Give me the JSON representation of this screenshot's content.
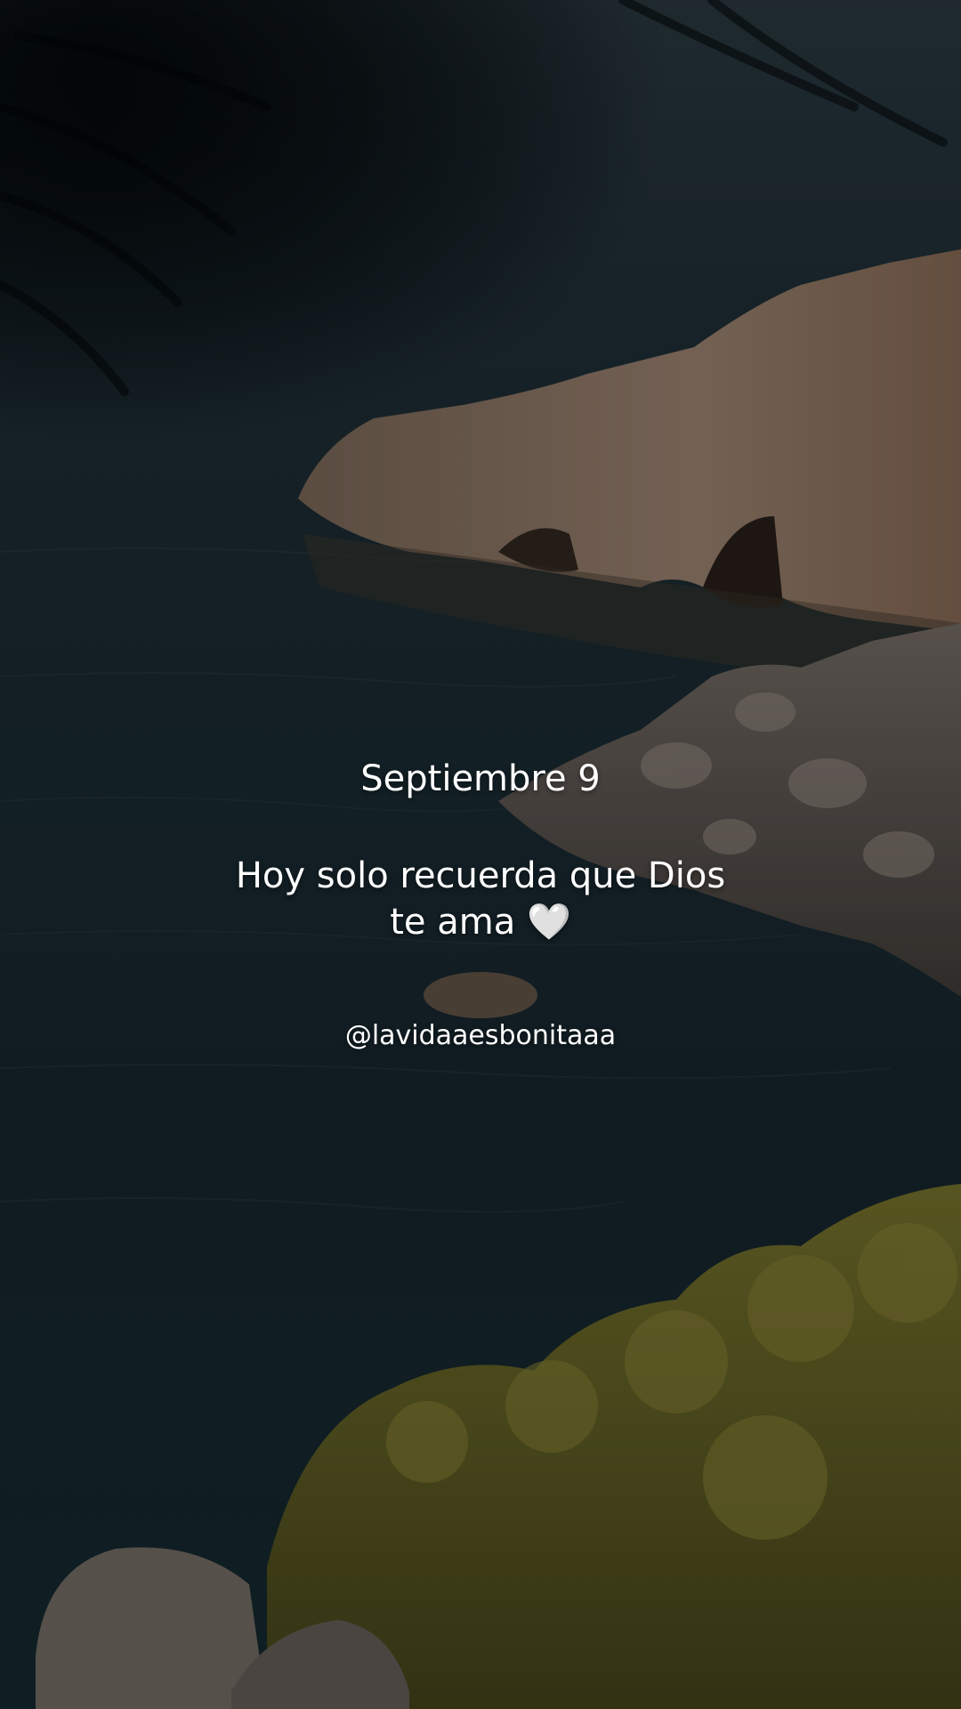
{
  "post": {
    "date": "Septiembre 9",
    "message_line1": "Hoy solo recuerda que Dios",
    "message_line2": "te ama 🤍",
    "handle": "@lavidaaesbonitaaa"
  },
  "scene": {
    "description_icon": "coastal-cliff-sea-background",
    "palette": {
      "sea": "#162a30",
      "cliff": "#8a7563",
      "vegetation": "#5c5a22",
      "shadow": "#060b0d"
    }
  }
}
